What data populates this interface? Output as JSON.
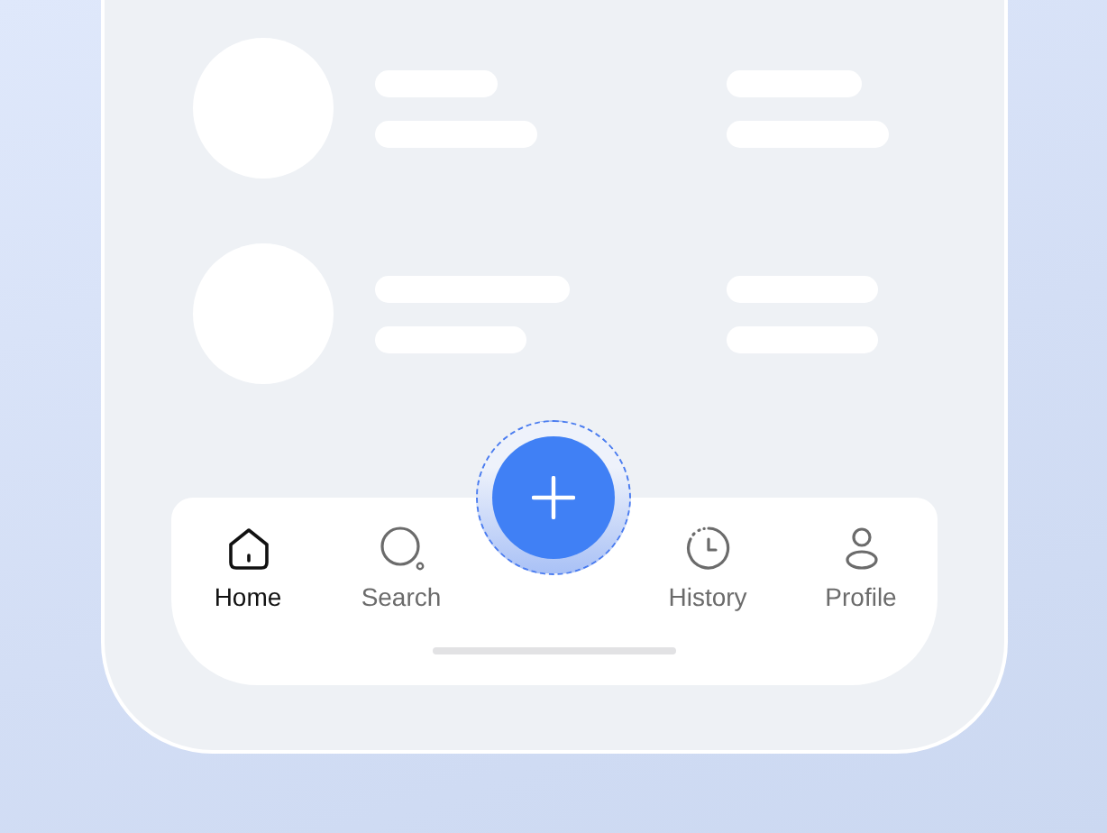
{
  "nav": {
    "items": [
      {
        "label": "Home",
        "kind": "home",
        "selected": true
      },
      {
        "label": "Search",
        "kind": "search",
        "selected": false
      },
      {
        "label": "History",
        "kind": "history",
        "selected": false
      },
      {
        "label": "Profile",
        "kind": "profile",
        "selected": false
      }
    ]
  }
}
